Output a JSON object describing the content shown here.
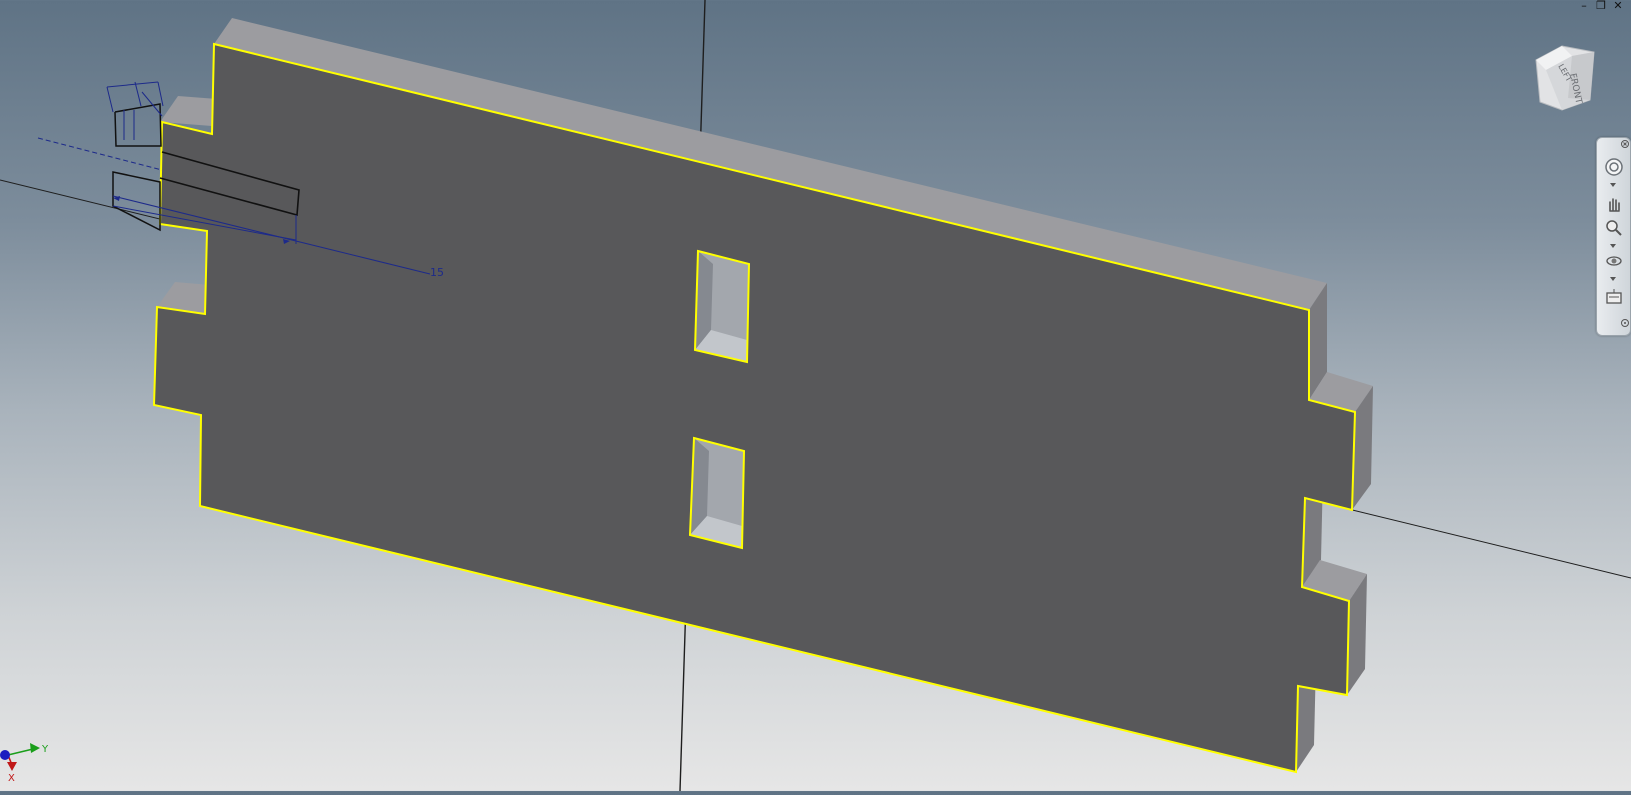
{
  "window_controls": {
    "minimize": "–",
    "restore": "❐",
    "close": "✕"
  },
  "viewcube": {
    "face_left": "LEFT",
    "face_front": "FRONT"
  },
  "sketch": {
    "dimension": "15"
  },
  "triad": {
    "x_label": "X",
    "y_label": "Y"
  },
  "navbar": {
    "icons": [
      "close-icon",
      "steering-wheel-icon",
      "pan-icon",
      "zoom-icon",
      "orbit-icon",
      "look-at-icon",
      "customize-icon"
    ]
  },
  "colors": {
    "part_face": "#58585a",
    "part_edge_highlight": "#ffff00",
    "part_top": "#9d9da1",
    "part_side": "#868689",
    "sketch": "#1d2a8a",
    "axis": "#202020"
  }
}
